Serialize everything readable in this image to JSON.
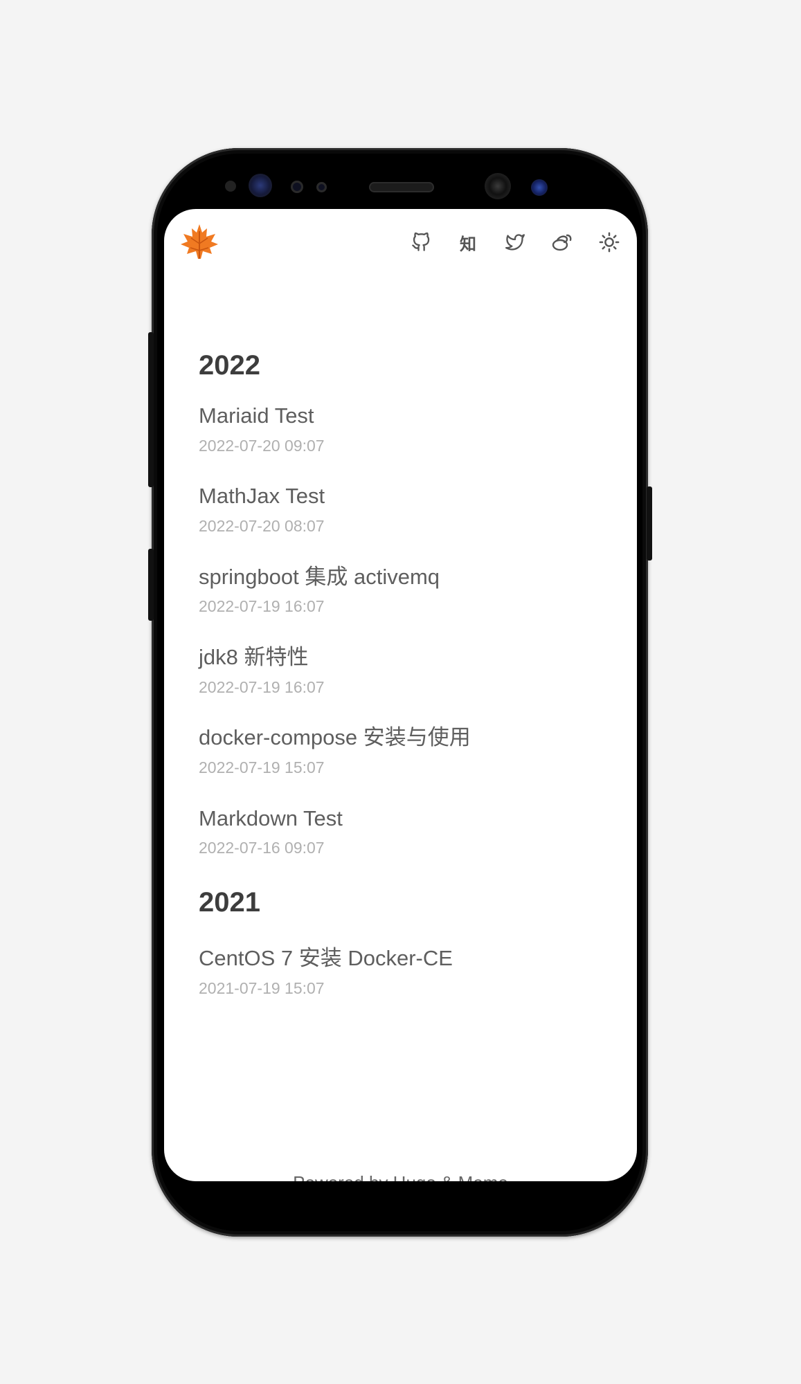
{
  "header": {
    "icons": [
      "github-icon",
      "zhihu-icon",
      "twitter-icon",
      "weibo-icon",
      "theme-toggle-icon"
    ],
    "zhihu_label": "知"
  },
  "archive": [
    {
      "year": "2022",
      "posts": [
        {
          "title": "Mariaid Test",
          "date": "2022-07-20 09:07"
        },
        {
          "title": "MathJax Test",
          "date": "2022-07-20 08:07"
        },
        {
          "title": "springboot 集成 activemq",
          "date": "2022-07-19 16:07"
        },
        {
          "title": "jdk8 新特性",
          "date": "2022-07-19 16:07"
        },
        {
          "title": "docker-compose 安装与使用",
          "date": "2022-07-19 15:07"
        },
        {
          "title": "Markdown Test",
          "date": "2022-07-16 09:07"
        }
      ]
    },
    {
      "year": "2021",
      "posts": [
        {
          "title": "CentOS 7 安装 Docker-CE",
          "date": "2021-07-19 15:07"
        }
      ]
    }
  ],
  "footer": {
    "text": "Powered by Hugo & Meme"
  },
  "colors": {
    "logo": "#f07a22",
    "background": "#f4f4f4",
    "text": "#5e5e5e",
    "date": "#b0b0b0"
  }
}
